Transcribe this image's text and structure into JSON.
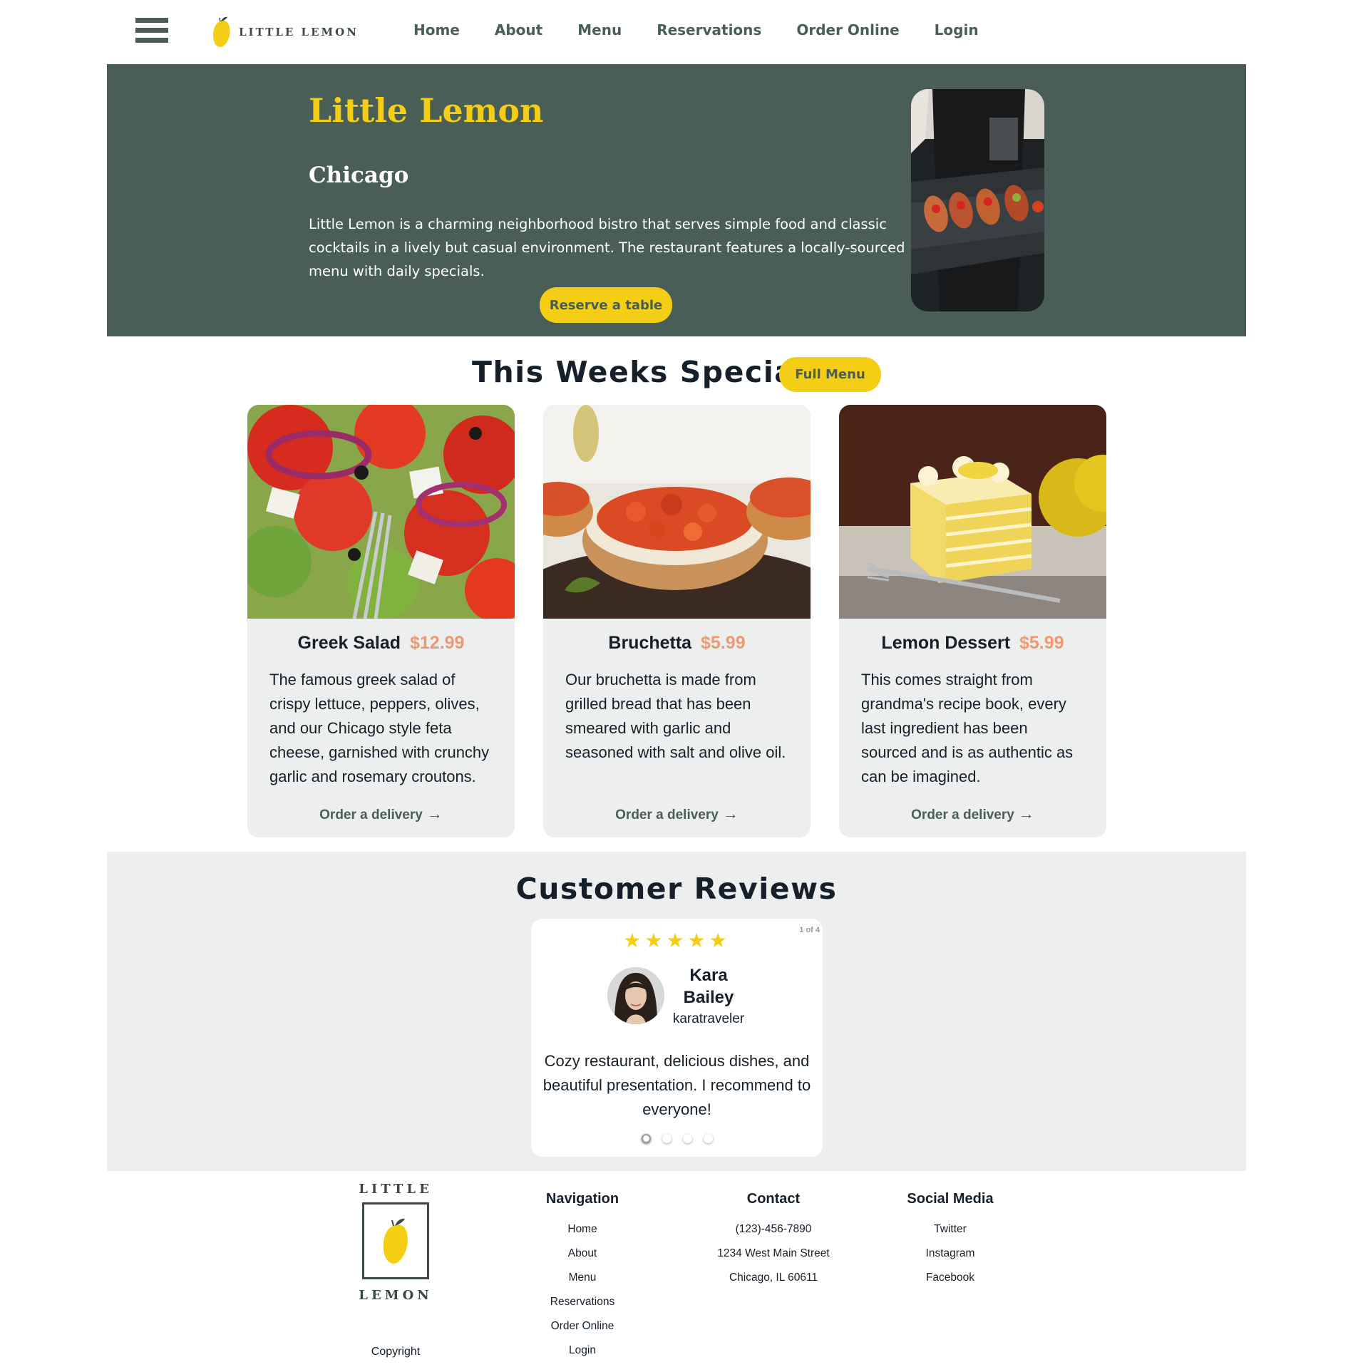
{
  "header": {
    "logo_text": "LITTLE LEMON",
    "nav": [
      "Home",
      "About",
      "Menu",
      "Reservations",
      "Order Online",
      "Login"
    ]
  },
  "hero": {
    "title": "Little Lemon",
    "subtitle": "Chicago",
    "description": "Little Lemon is a charming neighborhood bistro that serves simple food and classic cocktails in a lively but casual environment. The restaurant features a locally-sourced menu with daily specials.",
    "reserve_label": "Reserve a table"
  },
  "specials": {
    "heading": "This Weeks Specials",
    "full_menu_label": "Full Menu",
    "items": [
      {
        "name": "Greek Salad",
        "price": "$12.99",
        "description": "The famous greek salad of crispy lettuce, peppers, olives, and our Chicago style feta cheese, garnished with crunchy garlic and rosemary croutons.",
        "link": "Order a delivery"
      },
      {
        "name": "Bruchetta",
        "price": "$5.99",
        "description": "Our bruchetta is made from grilled bread that has been smeared with garlic and seasoned with salt and olive oil.",
        "link": "Order a delivery"
      },
      {
        "name": "Lemon Dessert",
        "price": "$5.99",
        "description": "This comes straight from grandma's recipe book, every last ingredient has been sourced and is as authentic as can be imagined.",
        "link": "Order a delivery"
      }
    ]
  },
  "reviews": {
    "heading": "Customer Reviews",
    "counter": "1 of 4",
    "rating_value": 5,
    "name": "Kara Bailey",
    "username": "karatraveler",
    "text": "Cozy restaurant, delicious dishes, and beautiful presentation. I recommend to everyone!"
  },
  "footer": {
    "logo_top": "LITTLE",
    "logo_bottom": "LEMON",
    "copyright": "Copyright",
    "navigation": {
      "heading": "Navigation",
      "links": [
        "Home",
        "About",
        "Menu",
        "Reservations",
        "Order Online",
        "Login"
      ]
    },
    "contact": {
      "heading": "Contact",
      "phone": "(123)-456-7890",
      "street": "1234 West Main Street",
      "city": "Chicago, IL 60611"
    },
    "social": {
      "heading": "Social Media",
      "links": [
        "Twitter",
        "Instagram",
        "Facebook"
      ]
    }
  },
  "colors": {
    "primary_green": "#495e57",
    "primary_yellow": "#f4ce14",
    "price_orange": "#ee9972",
    "highlight_gray": "#edefee"
  },
  "icons": {
    "menu": "hamburger-icon",
    "arrow": "arrow-right-icon",
    "star": "star-icon"
  }
}
